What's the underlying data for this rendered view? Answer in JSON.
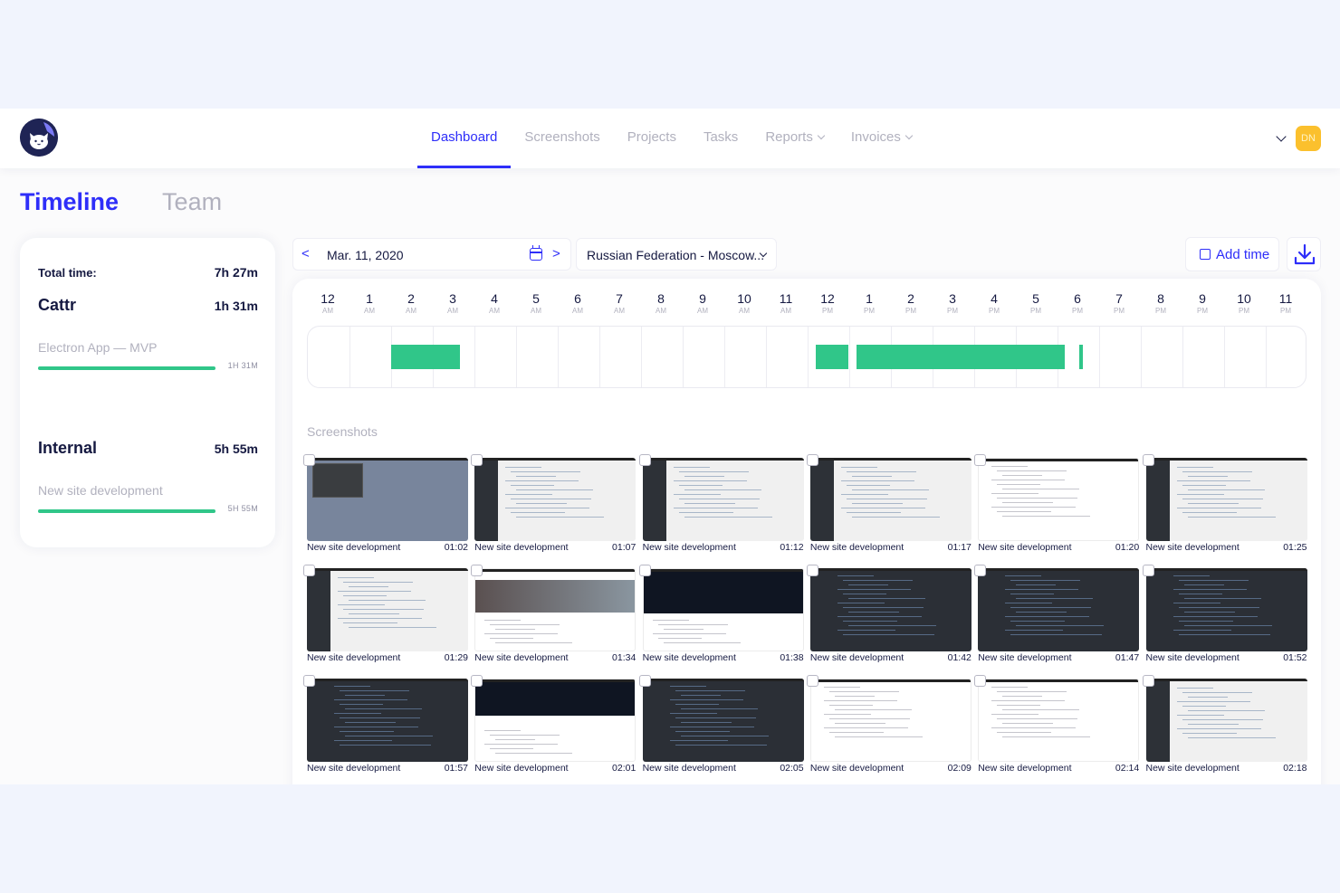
{
  "nav": {
    "items": [
      {
        "label": "Dashboard",
        "active": true,
        "dropdown": false
      },
      {
        "label": "Screenshots",
        "active": false,
        "dropdown": false
      },
      {
        "label": "Projects",
        "active": false,
        "dropdown": false
      },
      {
        "label": "Tasks",
        "active": false,
        "dropdown": false
      },
      {
        "label": "Reports",
        "active": false,
        "dropdown": true
      },
      {
        "label": "Invoices",
        "active": false,
        "dropdown": true
      }
    ],
    "avatar_initials": "DN"
  },
  "tabs": {
    "timeline": "Timeline",
    "team": "Team"
  },
  "summary": {
    "total_label": "Total time:",
    "total_value": "7h 27m",
    "projects": [
      {
        "name": "Cattr",
        "time": "1h 31m",
        "task": "Electron App — MVP",
        "task_time": "1H 31M"
      },
      {
        "name": "Internal",
        "time": "5h 55m",
        "task": "New site development",
        "task_time": "5H 55M"
      }
    ]
  },
  "toolbar": {
    "prev": "<",
    "next": ">",
    "date": "Mar. 11, 2020",
    "timezone": "Russian Federation - Moscow...",
    "add_time": "Add time"
  },
  "timeline": {
    "hours": [
      {
        "h": "12",
        "p": "AM"
      },
      {
        "h": "1",
        "p": "AM"
      },
      {
        "h": "2",
        "p": "AM"
      },
      {
        "h": "3",
        "p": "AM"
      },
      {
        "h": "4",
        "p": "AM"
      },
      {
        "h": "5",
        "p": "AM"
      },
      {
        "h": "6",
        "p": "AM"
      },
      {
        "h": "7",
        "p": "AM"
      },
      {
        "h": "8",
        "p": "AM"
      },
      {
        "h": "9",
        "p": "AM"
      },
      {
        "h": "10",
        "p": "AM"
      },
      {
        "h": "11",
        "p": "AM"
      },
      {
        "h": "12",
        "p": "PM"
      },
      {
        "h": "1",
        "p": "PM"
      },
      {
        "h": "2",
        "p": "PM"
      },
      {
        "h": "3",
        "p": "PM"
      },
      {
        "h": "4",
        "p": "PM"
      },
      {
        "h": "5",
        "p": "PM"
      },
      {
        "h": "6",
        "p": "PM"
      },
      {
        "h": "7",
        "p": "PM"
      },
      {
        "h": "8",
        "p": "PM"
      },
      {
        "h": "9",
        "p": "PM"
      },
      {
        "h": "10",
        "p": "PM"
      },
      {
        "h": "11",
        "p": "PM"
      }
    ],
    "segments": [
      {
        "start": 2.0,
        "end": 3.65
      },
      {
        "start": 12.2,
        "end": 12.98
      },
      {
        "start": 13.18,
        "end": 18.18
      },
      {
        "start": 18.52,
        "end": 18.6
      }
    ],
    "segment_color": "#30c689"
  },
  "screenshots": {
    "title": "Screenshots",
    "items": [
      {
        "task": "New site development",
        "time": "01:02",
        "style": "blue"
      },
      {
        "task": "New site development",
        "time": "01:07",
        "style": "ide"
      },
      {
        "task": "New site development",
        "time": "01:12",
        "style": "ide"
      },
      {
        "task": "New site development",
        "time": "01:17",
        "style": "ide"
      },
      {
        "task": "New site development",
        "time": "01:20",
        "style": "light"
      },
      {
        "task": "New site development",
        "time": "01:25",
        "style": "ide"
      },
      {
        "task": "New site development",
        "time": "01:29",
        "style": "ide"
      },
      {
        "task": "New site development",
        "time": "01:34",
        "style": "web"
      },
      {
        "task": "New site development",
        "time": "01:38",
        "style": "banner"
      },
      {
        "task": "New site development",
        "time": "01:42",
        "style": "dark"
      },
      {
        "task": "New site development",
        "time": "01:47",
        "style": "dark"
      },
      {
        "task": "New site development",
        "time": "01:52",
        "style": "dark"
      },
      {
        "task": "New site development",
        "time": "01:57",
        "style": "dark"
      },
      {
        "task": "New site development",
        "time": "02:01",
        "style": "banner2"
      },
      {
        "task": "New site development",
        "time": "02:05",
        "style": "dark"
      },
      {
        "task": "New site development",
        "time": "02:09",
        "style": "light"
      },
      {
        "task": "New site development",
        "time": "02:14",
        "style": "light"
      },
      {
        "task": "New site development",
        "time": "02:18",
        "style": "ide"
      }
    ]
  },
  "colors": {
    "accent": "#2e2ef9",
    "progress": "#30c689",
    "muted": "#b1b1be",
    "text": "#151941",
    "avatar": "#fbc02d"
  }
}
